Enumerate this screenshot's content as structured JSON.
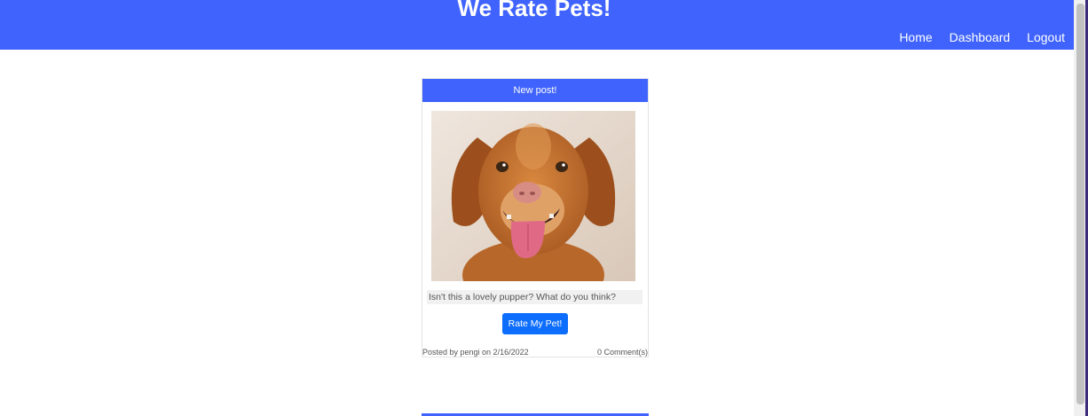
{
  "header": {
    "title": "We Rate Pets!",
    "nav": [
      "Home",
      "Dashboard",
      "Logout"
    ]
  },
  "post": {
    "header": "New post!",
    "image_alt": "smiling golden dog",
    "caption": "Isn't this a lovely pupper? What do you think?",
    "rate_label": "Rate My Pet!",
    "posted_by": "Posted by pengi on 2/16/2022",
    "comments": "0 Comment(s)"
  },
  "colors": {
    "brand": "#3f63fc",
    "button": "#0d6efd"
  }
}
